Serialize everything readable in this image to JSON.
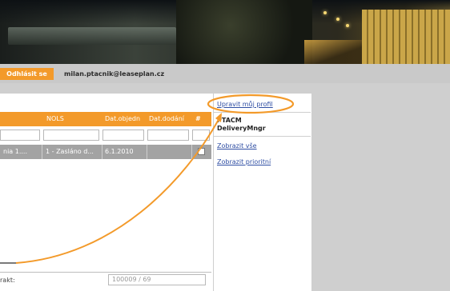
{
  "header": {
    "logout_label": "Odhlásit se",
    "user_email": "milan.ptacnik@leaseplan.cz"
  },
  "grid": {
    "columns": [
      "NOLS",
      "Dat.objedn",
      "Dat.dodání",
      "#"
    ],
    "rows": [
      {
        "c1": "nia 1....",
        "c2": "1 - Zasláno d...",
        "c3": "6.1.2010"
      }
    ]
  },
  "sidebar": {
    "edit_profile": "Upravit můj profil",
    "role_line1": "PTACM",
    "role_line2": "DeliveryMngr",
    "show_all": "Zobrazit vše",
    "show_priority": "Zobrazit prioritní"
  },
  "footer": {
    "label": "rakt:",
    "field_value": "100009 / 69"
  },
  "colors": {
    "accent": "#f39a2a",
    "link": "#2f4ea3"
  }
}
